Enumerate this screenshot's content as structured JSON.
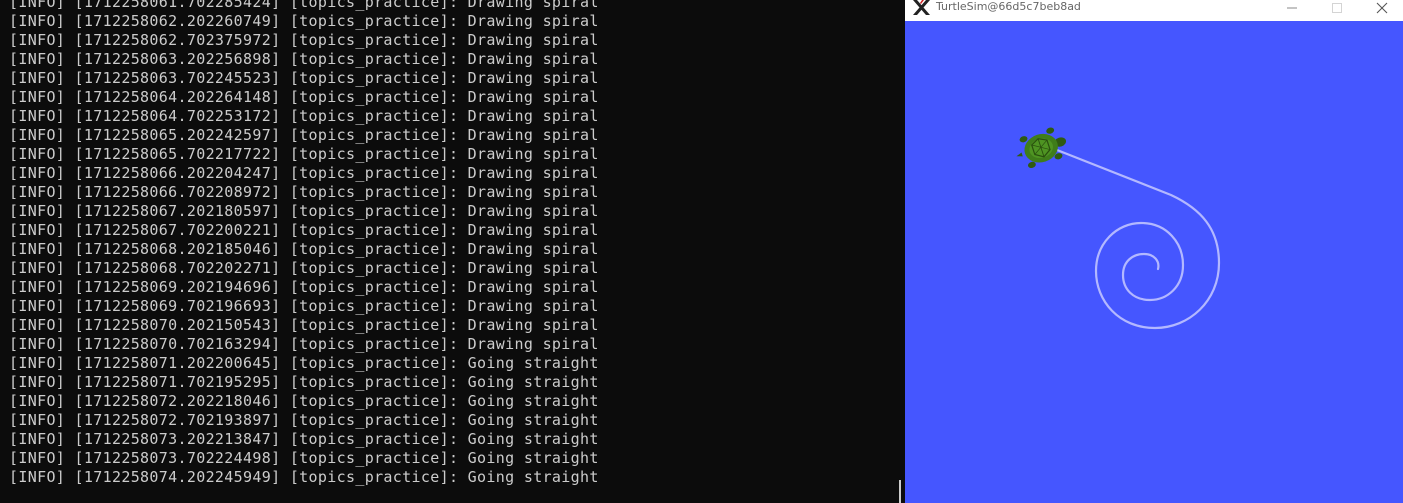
{
  "terminal": {
    "lines": [
      "[INFO] [1712258061.702285424] [topics_practice]: Drawing spiral",
      "[INFO] [1712258062.202260749] [topics_practice]: Drawing spiral",
      "[INFO] [1712258062.702375972] [topics_practice]: Drawing spiral",
      "[INFO] [1712258063.202256898] [topics_practice]: Drawing spiral",
      "[INFO] [1712258063.702245523] [topics_practice]: Drawing spiral",
      "[INFO] [1712258064.202264148] [topics_practice]: Drawing spiral",
      "[INFO] [1712258064.702253172] [topics_practice]: Drawing spiral",
      "[INFO] [1712258065.202242597] [topics_practice]: Drawing spiral",
      "[INFO] [1712258065.702217722] [topics_practice]: Drawing spiral",
      "[INFO] [1712258066.202204247] [topics_practice]: Drawing spiral",
      "[INFO] [1712258066.702208972] [topics_practice]: Drawing spiral",
      "[INFO] [1712258067.202180597] [topics_practice]: Drawing spiral",
      "[INFO] [1712258067.702200221] [topics_practice]: Drawing spiral",
      "[INFO] [1712258068.202185046] [topics_practice]: Drawing spiral",
      "[INFO] [1712258068.702202271] [topics_practice]: Drawing spiral",
      "[INFO] [1712258069.202194696] [topics_practice]: Drawing spiral",
      "[INFO] [1712258069.702196693] [topics_practice]: Drawing spiral",
      "[INFO] [1712258070.202150543] [topics_practice]: Drawing spiral",
      "[INFO] [1712258070.702163294] [topics_practice]: Drawing spiral",
      "[INFO] [1712258071.202200645] [topics_practice]: Going straight",
      "[INFO] [1712258071.702195295] [topics_practice]: Going straight",
      "[INFO] [1712258072.202218046] [topics_practice]: Going straight",
      "[INFO] [1712258072.702193897] [topics_practice]: Going straight",
      "[INFO] [1712258073.202213847] [topics_practice]: Going straight",
      "[INFO] [1712258073.702224498] [topics_practice]: Going straight",
      "[INFO] [1712258074.202245949] [topics_practice]: Going straight"
    ]
  },
  "turtlesim": {
    "title": "TurtleSim@66d5c7beb8ad",
    "app_icon": "x11-icon",
    "controls": {
      "minimize": "minimize-icon",
      "maximize": "maximize-icon",
      "close": "close-icon"
    },
    "colors": {
      "background": "#4556ff",
      "pen": "#b3b8ff",
      "turtle_shell": "#3f7d1a",
      "turtle_body": "#2f5a12"
    },
    "turtle_icon": "turtle-icon"
  }
}
